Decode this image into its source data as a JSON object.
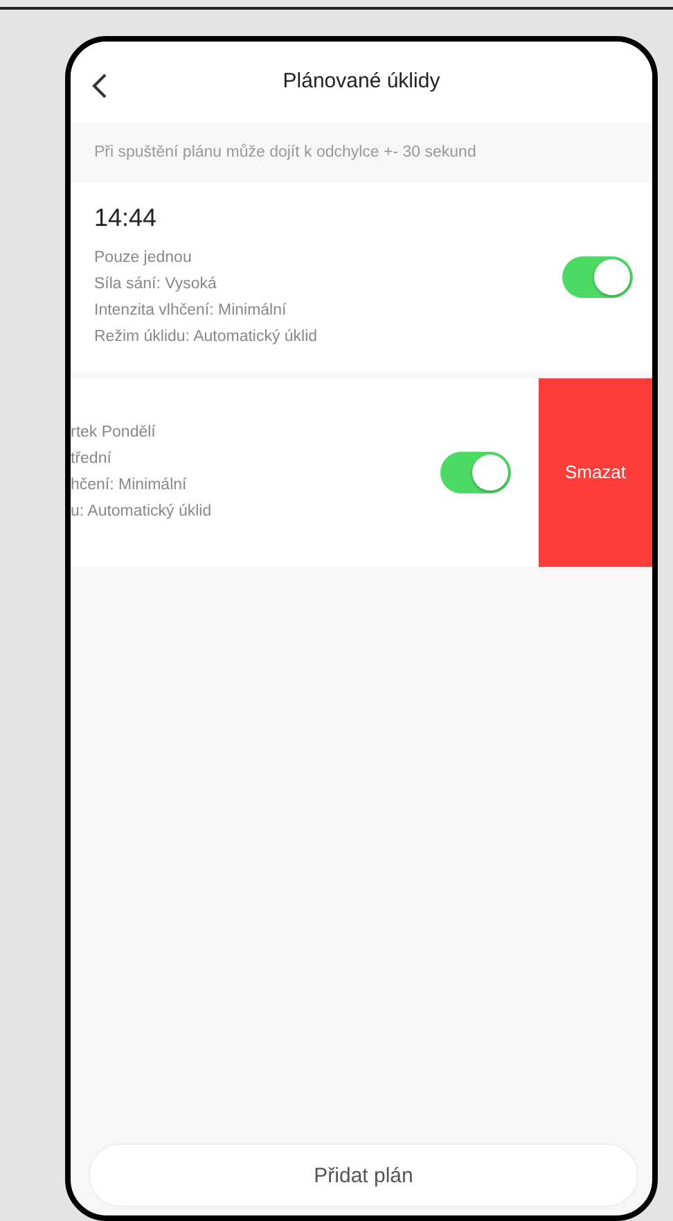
{
  "header": {
    "title": "Plánované úklidy"
  },
  "notice": "Při spuštění plánu může dojít k odchylce +- 30 sekund",
  "schedules": [
    {
      "time": "14:44",
      "lines": [
        "Pouze jednou",
        "Síla sání: Vysoká",
        "Intenzita vlhčení: Minimální",
        "Režim úklidu: Automatický úklid"
      ],
      "on": true,
      "swiped": false
    },
    {
      "lines": [
        "rtek Pondělí",
        "třední",
        "hčení: Minimální",
        "u: Automatický úklid"
      ],
      "on": true,
      "swiped": true,
      "delete_label": "Smazat"
    }
  ],
  "add_button": "Přidat plán"
}
